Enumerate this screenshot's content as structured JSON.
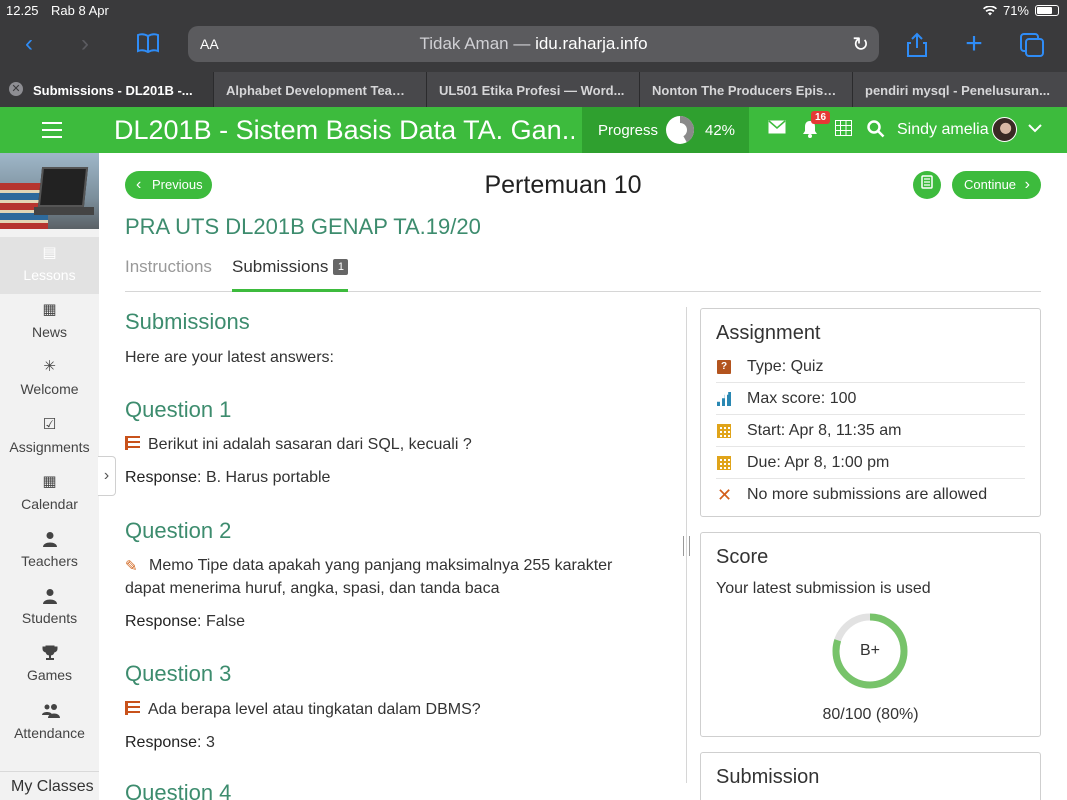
{
  "status": {
    "time": "12.25",
    "date": "Rab 8 Apr",
    "battery": "71%"
  },
  "browser": {
    "text_size_label": "AA",
    "url_prefix": "Tidak Aman — ",
    "url_host": "idu.raharja.info",
    "tabs": [
      {
        "label": "Submissions - DL201B -...",
        "active": true
      },
      {
        "label": "Alphabet Development Team..."
      },
      {
        "label": "UL501 Etika Profesi — Word..."
      },
      {
        "label": "Nonton The Producers Episo..."
      },
      {
        "label": "pendiri mysql - Penelusuran..."
      }
    ]
  },
  "header": {
    "course_title": "DL201B - Sistem Basis Data TA. Gan...",
    "progress_label": "Progress",
    "progress_value": 42,
    "progress_text": "42%",
    "notification_count": "16",
    "user_name": "Sindy amelia",
    "accent_color": "#3dbb3d"
  },
  "sidebar": {
    "items": [
      {
        "label": "Lessons",
        "icon": "lessons-icon"
      },
      {
        "label": "News",
        "icon": "news-icon"
      },
      {
        "label": "Welcome",
        "icon": "welcome-icon"
      },
      {
        "label": "Assignments",
        "icon": "assignments-icon"
      },
      {
        "label": "Calendar",
        "icon": "calendar-icon"
      },
      {
        "label": "Teachers",
        "icon": "teachers-icon"
      },
      {
        "label": "Students",
        "icon": "students-icon"
      },
      {
        "label": "Games",
        "icon": "trophy-icon"
      },
      {
        "label": "Attendance",
        "icon": "attendance-icon"
      }
    ],
    "my_classes": "My Classes"
  },
  "nav": {
    "previous": "Previous",
    "continue": "Continue",
    "page_title": "Pertemuan 10"
  },
  "assignment_title": "PRA UTS DL201B GENAP TA.19/20",
  "subtabs": {
    "instructions": "Instructions",
    "submissions": "Submissions",
    "submissions_count": "1"
  },
  "submissions": {
    "heading": "Submissions",
    "intro": "Here are your latest answers:",
    "response_label": "Response",
    "questions": [
      {
        "title": "Question 1",
        "text": "Berikut ini adalah sasaran dari SQL, kecuali ?",
        "response": ": B. Harus portable"
      },
      {
        "title": "Question 2",
        "text": "Memo Tipe data apakah yang panjang maksimalnya 255 karakter dapat menerima huruf, angka, spasi, dan tanda baca",
        "response": ": False"
      },
      {
        "title": "Question 3",
        "text": "Ada berapa level atau tingkatan dalam DBMS?",
        "response": ": 3"
      },
      {
        "title": "Question 4"
      }
    ]
  },
  "assignment_card": {
    "title": "Assignment",
    "type": "Type: Quiz",
    "max_score": "Max score: 100",
    "start": "Start: Apr 8, 11:35 am",
    "due": "Due: Apr 8, 1:00 pm",
    "submissions_note": "No more submissions are allowed"
  },
  "score_card": {
    "title": "Score",
    "subtitle": "Your latest submission is used",
    "grade": "B+",
    "fraction": 0.8,
    "value": "80/100 (80%)"
  },
  "submission_card": {
    "title": "Submission"
  }
}
